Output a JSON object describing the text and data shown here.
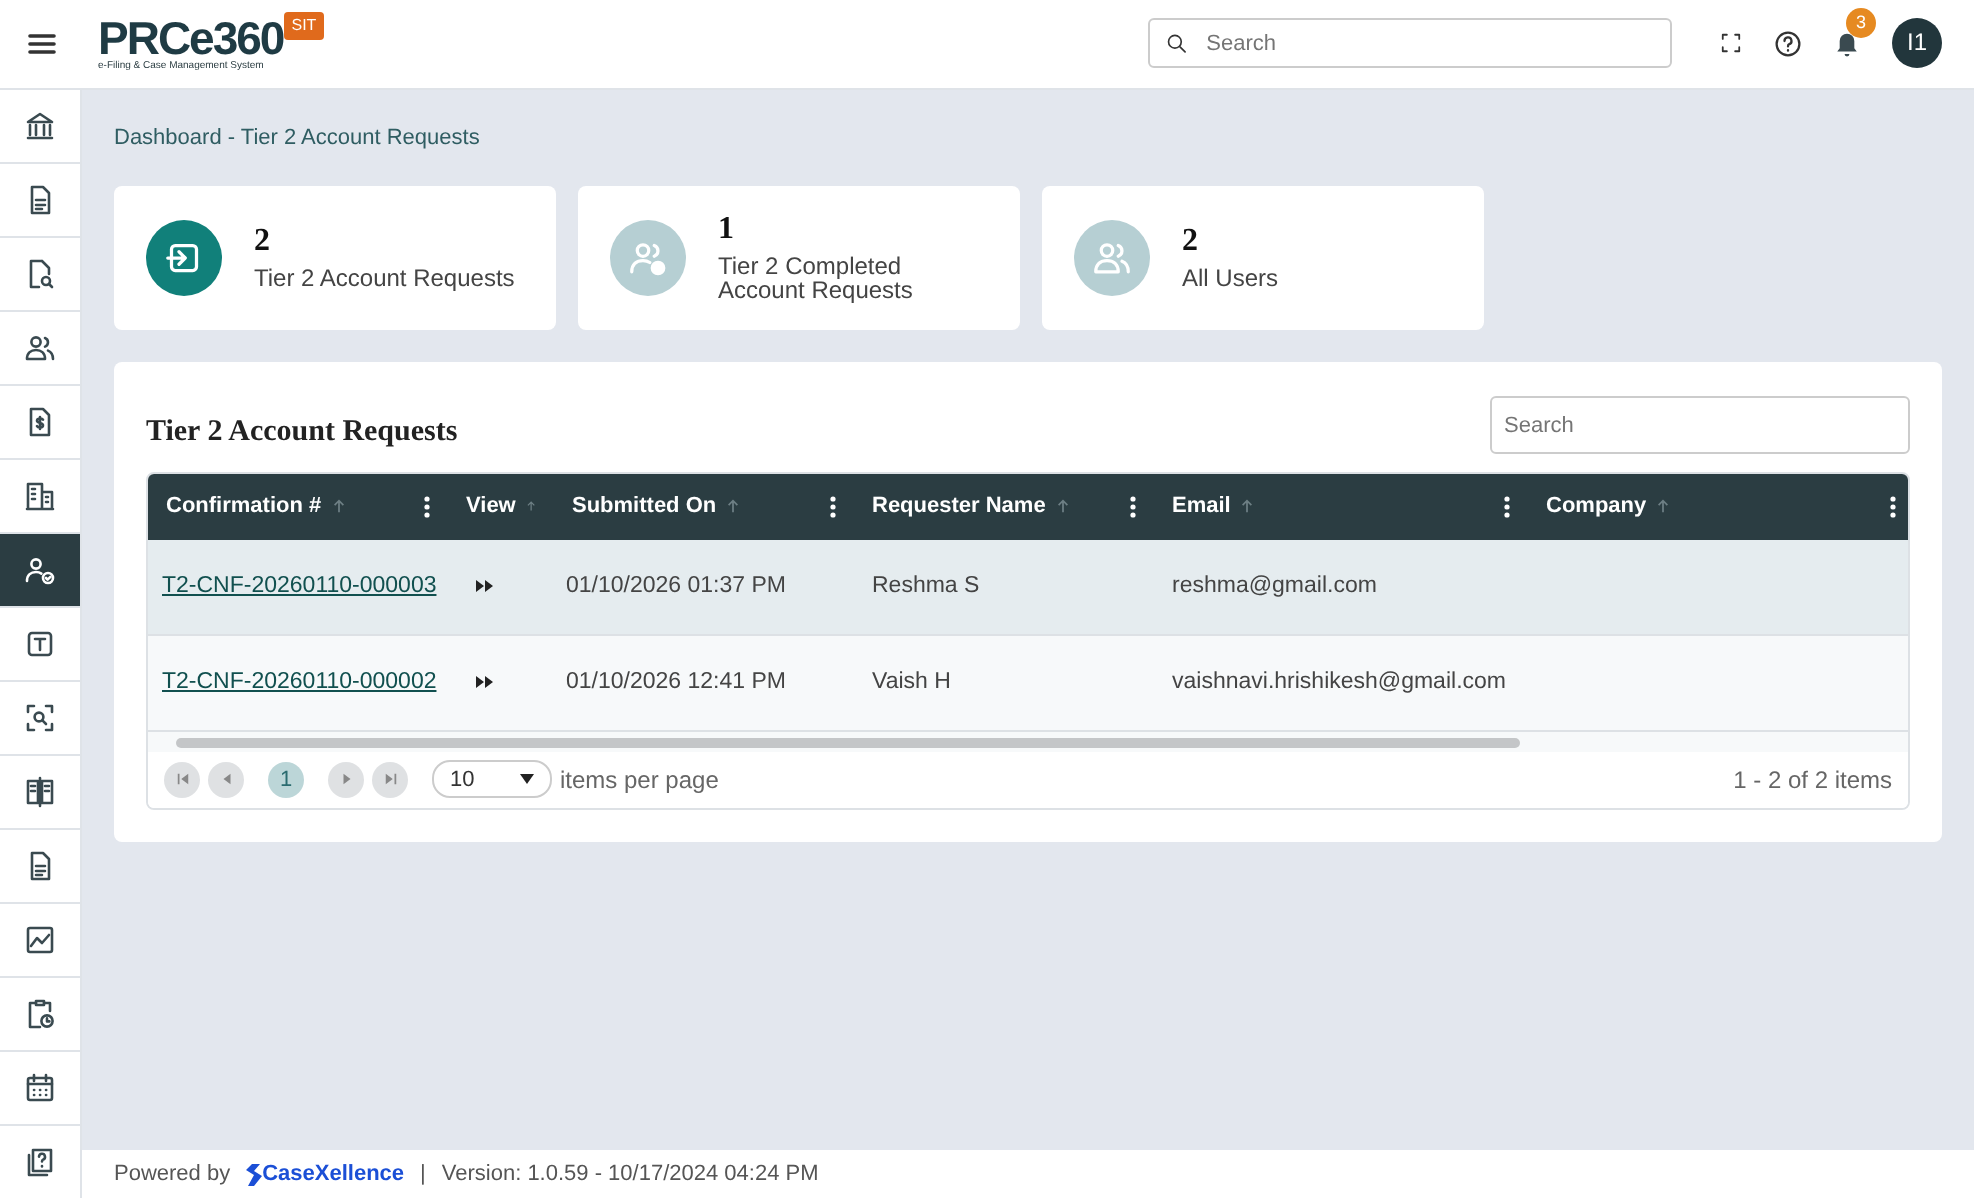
{
  "header": {
    "logo": "PRCe360",
    "tagline": "e-Filing & Case Management System",
    "env_badge": "SIT",
    "search": {
      "placeholder": "Search"
    },
    "notifications": "3",
    "avatar": "I1"
  },
  "sidebar": {
    "items": [
      {
        "selected": false
      },
      {
        "selected": false
      },
      {
        "selected": false
      },
      {
        "selected": false
      },
      {
        "selected": false
      },
      {
        "selected": false
      },
      {
        "selected": true
      },
      {
        "selected": false
      },
      {
        "selected": false
      },
      {
        "selected": false
      },
      {
        "selected": false
      },
      {
        "selected": false
      },
      {
        "selected": false
      },
      {
        "selected": false
      },
      {
        "selected": false
      }
    ]
  },
  "breadcrumb": "Dashboard - Tier 2 Account Requests",
  "stat_cards": [
    {
      "count": "2",
      "label": "Tier 2 Account Requests",
      "selected": true
    },
    {
      "count": "1",
      "label": "Tier 2 Completed Account Requests",
      "selected": false
    },
    {
      "count": "2",
      "label": "All Users",
      "selected": false
    }
  ],
  "table": {
    "title": "Tier 2 Account Requests",
    "search": {
      "placeholder": "Search"
    },
    "columns": [
      {
        "label": "Confirmation #",
        "menu": true
      },
      {
        "label": "View",
        "menu": false
      },
      {
        "label": "Submitted On",
        "menu": true
      },
      {
        "label": "Requester Name",
        "menu": true
      },
      {
        "label": "Email",
        "menu": true
      },
      {
        "label": "Company",
        "menu": true
      }
    ],
    "rows": [
      {
        "confirmation": "T2-CNF-20260110-000003",
        "submitted_on": "01/10/2026 01:37 PM",
        "requester": "Reshma S",
        "email": "reshma@gmail.com",
        "selected": true
      },
      {
        "confirmation": "T2-CNF-20260110-000002",
        "submitted_on": "01/10/2026 12:41 PM",
        "requester": "Vaish H",
        "email": "vaishnavi.hrishikesh@gmail.com",
        "selected": false
      }
    ],
    "pager": {
      "page": "1",
      "page_size": "10",
      "page_size_label": "items per page",
      "summary": "1 - 2 of 2 items"
    }
  },
  "footer": {
    "powered_by": "Powered by",
    "brand": "CaseXellence",
    "separator": "|",
    "version": "Version: 1.0.59 - 10/17/2024 04:24 PM"
  }
}
